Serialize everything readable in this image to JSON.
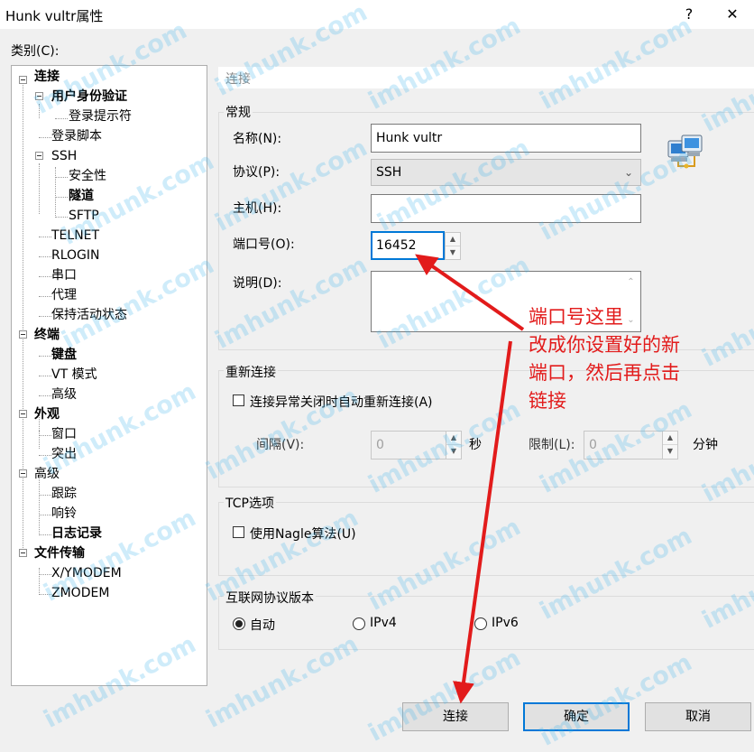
{
  "window": {
    "title": "Hunk vultr属性",
    "help_glyph": "?",
    "close_glyph": "✕"
  },
  "category_label": "类别(C):",
  "tree": [
    "连接",
    "用户身份验证",
    "登录提示符",
    "登录脚本",
    "SSH",
    "安全性",
    "隧道",
    "SFTP",
    "TELNET",
    "RLOGIN",
    "串口",
    "代理",
    "保持活动状态",
    "终端",
    "键盘",
    "VT 模式",
    "高级",
    "外观",
    "窗口",
    "突出",
    "高级",
    "跟踪",
    "响铃",
    "日志记录",
    "文件传输",
    "X/YMODEM",
    "ZMODEM"
  ],
  "section_header": "连接",
  "general": {
    "title": "常规",
    "name_label": "名称(N):",
    "name_value": "Hunk vultr",
    "protocol_label": "协议(P):",
    "protocol_value": "SSH",
    "host_label": "主机(H):",
    "host_value": "",
    "port_label": "端口号(O):",
    "port_value": "16452",
    "desc_label": "说明(D):",
    "desc_value": ""
  },
  "reconnect": {
    "title": "重新连接",
    "auto_label": "连接异常关闭时自动重新连接(A)",
    "auto_checked": false,
    "interval_label": "间隔(V):",
    "interval_value": "0",
    "interval_unit": "秒",
    "limit_label": "限制(L):",
    "limit_value": "0",
    "limit_unit": "分钟"
  },
  "tcp": {
    "title": "TCP选项",
    "nagle_label": "使用Nagle算法(U)",
    "nagle_checked": false
  },
  "ipver": {
    "title": "互联网协议版本",
    "options": [
      "自动",
      "IPv4",
      "IPv6"
    ],
    "selected": "自动"
  },
  "buttons": {
    "connect": "连接",
    "ok": "确定",
    "cancel": "取消"
  },
  "annotation": [
    "端口号这里",
    "改成你设置好的新",
    "端口，然后再点击",
    "链接"
  ],
  "watermark": "imhunk.com",
  "colors": {
    "annotation": "#e21b1b",
    "focus": "#0078d7",
    "watermark": "#46b4eb"
  }
}
